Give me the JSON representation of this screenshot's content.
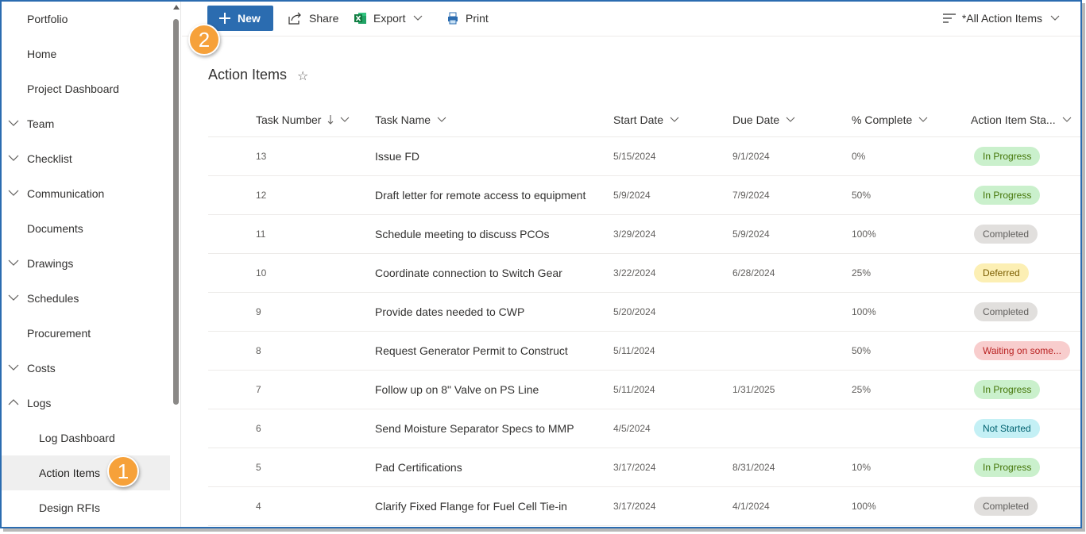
{
  "sidebar": {
    "items": [
      {
        "label": "Portfolio",
        "chevron": "none"
      },
      {
        "label": "Home",
        "chevron": "none"
      },
      {
        "label": "Project Dashboard",
        "chevron": "none"
      },
      {
        "label": "Team",
        "chevron": "down"
      },
      {
        "label": "Checklist",
        "chevron": "down"
      },
      {
        "label": "Communication",
        "chevron": "down"
      },
      {
        "label": "Documents",
        "chevron": "none"
      },
      {
        "label": "Drawings",
        "chevron": "down"
      },
      {
        "label": "Schedules",
        "chevron": "down"
      },
      {
        "label": "Procurement",
        "chevron": "none"
      },
      {
        "label": "Costs",
        "chevron": "down"
      },
      {
        "label": "Logs",
        "chevron": "up"
      },
      {
        "label": "Log Dashboard",
        "chevron": "none"
      },
      {
        "label": "Action Items",
        "chevron": "none"
      },
      {
        "label": "Design RFIs",
        "chevron": "none"
      }
    ]
  },
  "commandbar": {
    "new_label": "New",
    "share_label": "Share",
    "export_label": "Export",
    "print_label": "Print",
    "view_label": "*All Action Items"
  },
  "page": {
    "title": "Action Items"
  },
  "table": {
    "headers": {
      "task_number": "Task Number",
      "task_name": "Task Name",
      "start_date": "Start Date",
      "due_date": "Due Date",
      "percent_complete": "% Complete",
      "status": "Action Item Sta..."
    },
    "rows": [
      {
        "num": "13",
        "name": "Issue FD",
        "start": "5/15/2024",
        "due": "9/1/2024",
        "pct": "0%",
        "status": "In Progress",
        "status_class": "inprogress"
      },
      {
        "num": "12",
        "name": "Draft letter for remote access to equipment",
        "start": "5/9/2024",
        "due": "7/9/2024",
        "pct": "50%",
        "status": "In Progress",
        "status_class": "inprogress"
      },
      {
        "num": "11",
        "name": "Schedule meeting to discuss PCOs",
        "start": "3/29/2024",
        "due": "5/9/2024",
        "pct": "100%",
        "status": "Completed",
        "status_class": "completed"
      },
      {
        "num": "10",
        "name": "Coordinate connection to Switch Gear",
        "start": "3/22/2024",
        "due": "6/28/2024",
        "pct": "25%",
        "status": "Deferred",
        "status_class": "deferred"
      },
      {
        "num": "9",
        "name": "Provide dates needed to CWP",
        "start": "5/20/2024",
        "due": "",
        "pct": "100%",
        "status": "Completed",
        "status_class": "completed"
      },
      {
        "num": "8",
        "name": "Request Generator Permit to Construct",
        "start": "5/11/2024",
        "due": "",
        "pct": "50%",
        "status": "Waiting on some...",
        "status_class": "waiting"
      },
      {
        "num": "7",
        "name": "Follow up on 8\" Valve on PS Line",
        "start": "5/11/2024",
        "due": "1/31/2025",
        "pct": "25%",
        "status": "In Progress",
        "status_class": "inprogress"
      },
      {
        "num": "6",
        "name": "Send Moisture Separator Specs to MMP",
        "start": "4/5/2024",
        "due": "",
        "pct": "",
        "status": "Not Started",
        "status_class": "notstarted"
      },
      {
        "num": "5",
        "name": "Pad Certifications",
        "start": "3/17/2024",
        "due": "8/31/2024",
        "pct": "10%",
        "status": "In Progress",
        "status_class": "inprogress"
      },
      {
        "num": "4",
        "name": "Clarify Fixed Flange for Fuel Cell Tie-in",
        "start": "3/17/2024",
        "due": "4/1/2024",
        "pct": "100%",
        "status": "Completed",
        "status_class": "completed"
      }
    ]
  },
  "callouts": [
    "1",
    "2"
  ],
  "colors": {
    "accent": "#2b6cb0",
    "callout": "#f6a13a",
    "selected_bg": "#efefef"
  }
}
